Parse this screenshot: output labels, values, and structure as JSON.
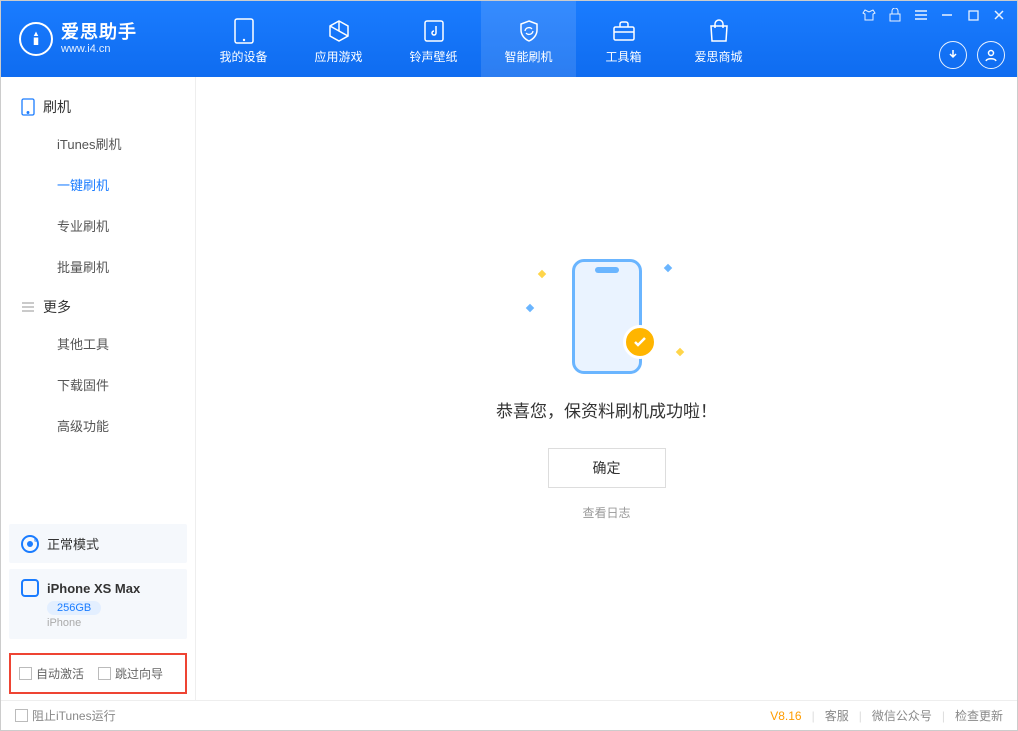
{
  "app": {
    "name": "爱思助手",
    "url": "www.i4.cn"
  },
  "nav": [
    {
      "label": "我的设备"
    },
    {
      "label": "应用游戏"
    },
    {
      "label": "铃声壁纸"
    },
    {
      "label": "智能刷机"
    },
    {
      "label": "工具箱"
    },
    {
      "label": "爱思商城"
    }
  ],
  "sidebar": {
    "group1": "刷机",
    "items1": [
      "iTunes刷机",
      "一键刷机",
      "专业刷机",
      "批量刷机"
    ],
    "group2": "更多",
    "items2": [
      "其他工具",
      "下载固件",
      "高级功能"
    ]
  },
  "mode": {
    "label": "正常模式"
  },
  "device": {
    "name": "iPhone XS Max",
    "storage": "256GB",
    "type": "iPhone"
  },
  "options": {
    "auto_activate": "自动激活",
    "skip_guide": "跳过向导"
  },
  "main": {
    "success": "恭喜您，保资料刷机成功啦！",
    "confirm": "确定",
    "log": "查看日志"
  },
  "footer": {
    "block_itunes": "阻止iTunes运行",
    "version": "V8.16",
    "support": "客服",
    "wechat": "微信公众号",
    "update": "检查更新"
  }
}
